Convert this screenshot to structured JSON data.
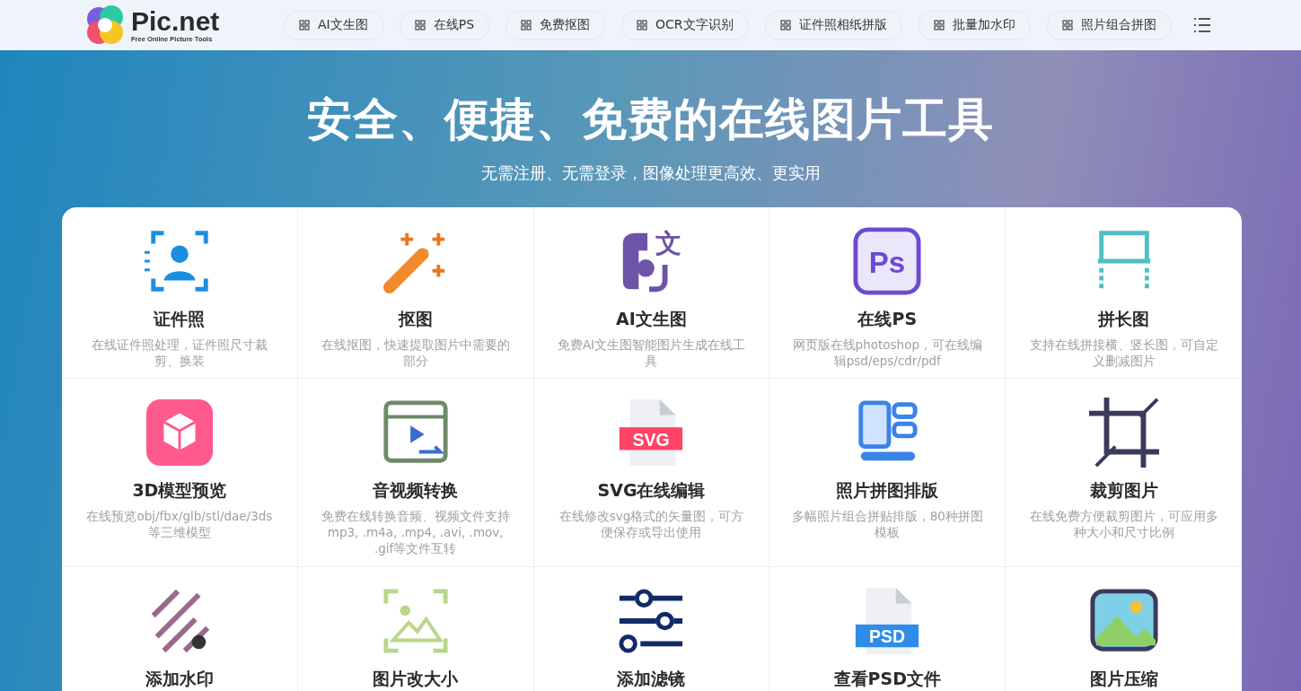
{
  "logo": {
    "name": "Pic.net",
    "tagline": "Free Online Picture Tools"
  },
  "nav": [
    {
      "label": "AI文生图"
    },
    {
      "label": "在线PS"
    },
    {
      "label": "免费抠图"
    },
    {
      "label": "OCR文字识别"
    },
    {
      "label": "证件照相纸拼版"
    },
    {
      "label": "批量加水印"
    },
    {
      "label": "照片组合拼图"
    }
  ],
  "hero": {
    "title": "安全、便捷、免费的在线图片工具",
    "subtitle": "无需注册、无需登录，图像处理更高效、更实用"
  },
  "tools": [
    {
      "title": "证件照",
      "desc": "在线证件照处理，证件照尺寸裁剪、换装"
    },
    {
      "title": "抠图",
      "desc": "在线抠图，快速提取图片中需要的部分"
    },
    {
      "title": "AI文生图",
      "desc": "免费AI文生图智能图片生成在线工具",
      "icon_text": "文"
    },
    {
      "title": "在线PS",
      "desc": "网页版在线photoshop，可在线编辑psd/eps/cdr/pdf",
      "icon_text": "Ps"
    },
    {
      "title": "拼长图",
      "desc": "支持在线拼接横、竖长图，可自定义删减图片"
    },
    {
      "title": "3D模型预览",
      "desc": "在线预览obj/fbx/glb/stl/dae/3ds等三维模型"
    },
    {
      "title": "音视频转换",
      "desc": "免费在线转换音频、视频文件支持mp3, .m4a, .mp4, .avi, .mov, .gif等文件互转"
    },
    {
      "title": "SVG在线编辑",
      "desc": "在线修改svg格式的矢量图，可方便保存或导出使用",
      "icon_text": "SVG"
    },
    {
      "title": "照片拼图排版",
      "desc": "多幅照片组合拼贴排版，80种拼图模板"
    },
    {
      "title": "裁剪图片",
      "desc": "在线免费方便裁剪图片，可应用多种大小和尺寸比例"
    },
    {
      "title": "添加水印"
    },
    {
      "title": "图片改大小"
    },
    {
      "title": "添加滤镜"
    },
    {
      "title": "查看PSD文件",
      "icon_text": "PSD"
    },
    {
      "title": "图片压缩"
    }
  ]
}
